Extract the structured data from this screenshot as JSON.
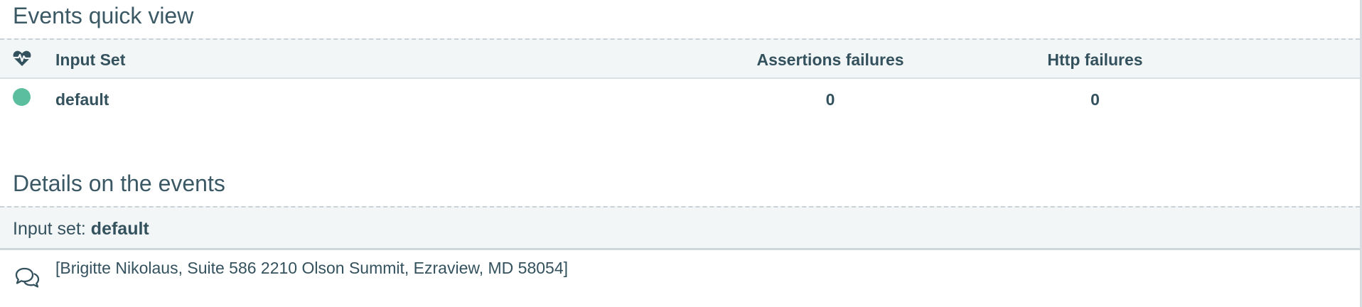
{
  "quick_view": {
    "title": "Events quick view",
    "columns": {
      "status_icon": "heart-pulse-icon",
      "input_set": "Input Set",
      "assertions_failures": "Assertions failures",
      "http_failures": "Http failures"
    },
    "rows": [
      {
        "status": "success",
        "status_color": "#5bbf9f",
        "input_set": "default",
        "assertions_failures": "0",
        "http_failures": "0"
      }
    ]
  },
  "details": {
    "title": "Details on the events",
    "input_set_prefix": "Input set: ",
    "input_set_name": "default",
    "events": [
      {
        "icon": "comments-icon",
        "text": "[Brigitte Nikolaus, Suite 586 2210 Olson Summit, Ezraview, MD 58054]"
      }
    ]
  },
  "colors": {
    "text": "#34525e",
    "header_bg": "#f3f6f7",
    "success": "#5bbf9f"
  }
}
